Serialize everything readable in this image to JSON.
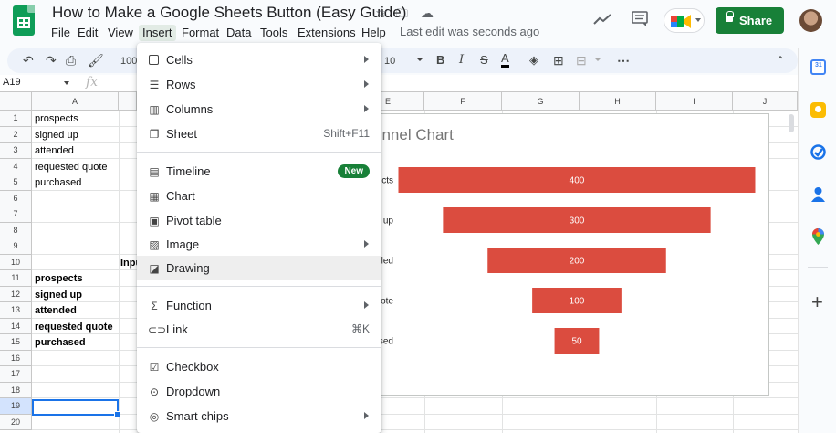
{
  "app": {
    "doc_title": "How to Make a Google Sheets Button (Easy Guide)",
    "last_edit": "Last edit was seconds ago",
    "share_label": "Share",
    "colors": {
      "accent": "#188038",
      "bar": "#db4c3f",
      "selection": "#1a73e8"
    }
  },
  "menubar": [
    "File",
    "Edit",
    "View",
    "Insert",
    "Format",
    "Data",
    "Tools",
    "Extensions",
    "Help"
  ],
  "toolbar": {
    "zoom": "100%",
    "font_size": "10"
  },
  "namebox": "A19",
  "fx": "fx",
  "columns": [
    "A",
    "E",
    "F",
    "G",
    "H",
    "I",
    "J"
  ],
  "rows": [
    "1",
    "2",
    "3",
    "4",
    "5",
    "6",
    "7",
    "8",
    "9",
    "10",
    "11",
    "12",
    "13",
    "14",
    "15",
    "16",
    "17",
    "18",
    "19",
    "20"
  ],
  "cells": {
    "a1": "prospects",
    "a2": "signed up",
    "a3": "attended",
    "a4": "requested quote",
    "a5": "purchased",
    "b10": "Inpu",
    "a11": "prospects",
    "a12": "signed up",
    "a13": "attended",
    "a14": "requested quote",
    "a15": "purchased"
  },
  "chart": {
    "title_visible": "unnel Chart",
    "partial_labels": [
      "cts",
      "up",
      "led",
      "ote",
      "sed"
    ]
  },
  "chart_data": {
    "type": "bar",
    "orientation": "horizontal-funnel",
    "title": "unnel Chart",
    "categories": [
      "prospects",
      "signed up",
      "attended",
      "requested quote",
      "purchased"
    ],
    "values": [
      400,
      300,
      200,
      100,
      50
    ],
    "max": 480,
    "color": "#db4c3f"
  },
  "insert_menu": [
    {
      "label": "Cells",
      "icon": "cells-icon",
      "shortcut": "",
      "arrow": true
    },
    {
      "label": "Rows",
      "icon": "rows-icon",
      "shortcut": "",
      "arrow": true
    },
    {
      "label": "Columns",
      "icon": "columns-icon",
      "shortcut": "",
      "arrow": true
    },
    {
      "label": "Sheet",
      "icon": "sheet-icon",
      "shortcut": "Shift+F11",
      "arrow": false
    },
    {
      "label": "Timeline",
      "icon": "timeline-icon",
      "shortcut": "",
      "arrow": false,
      "badge": "New"
    },
    {
      "label": "Chart",
      "icon": "chart-icon",
      "shortcut": "",
      "arrow": false
    },
    {
      "label": "Pivot table",
      "icon": "pivot-table-icon",
      "shortcut": "",
      "arrow": false
    },
    {
      "label": "Image",
      "icon": "image-icon",
      "shortcut": "",
      "arrow": true
    },
    {
      "label": "Drawing",
      "icon": "drawing-icon",
      "shortcut": "",
      "arrow": false
    },
    {
      "label": "Function",
      "icon": "function-icon",
      "shortcut": "",
      "arrow": true
    },
    {
      "label": "Link",
      "icon": "link-icon",
      "shortcut": "⌘K",
      "arrow": false
    },
    {
      "label": "Checkbox",
      "icon": "checkbox-icon",
      "shortcut": "",
      "arrow": false
    },
    {
      "label": "Dropdown",
      "icon": "dropdown-icon",
      "shortcut": "",
      "arrow": false
    },
    {
      "label": "Smart chips",
      "icon": "smart-chips-icon",
      "shortcut": "",
      "arrow": true
    }
  ]
}
